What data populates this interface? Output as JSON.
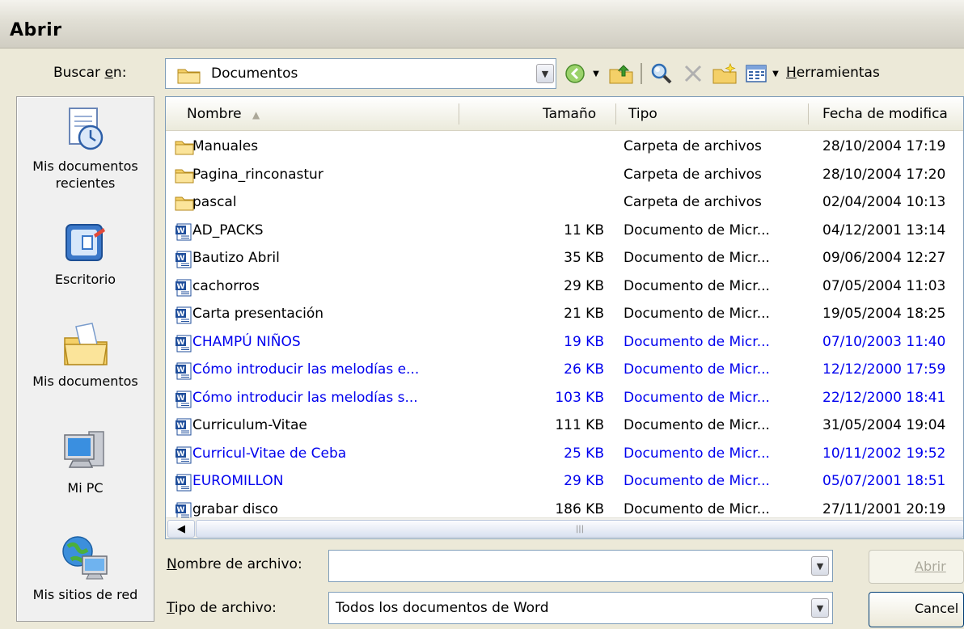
{
  "window": {
    "title": "Abrir"
  },
  "look_in": {
    "label_pre": "Buscar ",
    "label_key": "e",
    "label_post": "n:",
    "value": "Documentos"
  },
  "toolbar": {
    "tools_label_key": "H",
    "tools_label_rest": "erramientas"
  },
  "places": [
    {
      "line1": "Mis documentos",
      "line2": "recientes",
      "icon": "recent-documents-icon"
    },
    {
      "line1": "Escritorio",
      "line2": "",
      "icon": "desktop-icon"
    },
    {
      "line1": "Mis documentos",
      "line2": "",
      "icon": "my-documents-icon"
    },
    {
      "line1": "Mi PC",
      "line2": "",
      "icon": "my-computer-icon"
    },
    {
      "line1": "Mis sitios de red",
      "line2": "",
      "icon": "network-places-icon"
    }
  ],
  "columns": {
    "name": "Nombre",
    "size": "Tamaño",
    "type": "Tipo",
    "date": "Fecha de modifica"
  },
  "files": [
    {
      "name": "Manuales",
      "size": "",
      "type": "Carpeta de archivos",
      "date": "28/10/2004 17:19",
      "kind": "folder",
      "highlight": false
    },
    {
      "name": "Pagina_rinconastur",
      "size": "",
      "type": "Carpeta de archivos",
      "date": "28/10/2004 17:20",
      "kind": "folder",
      "highlight": false
    },
    {
      "name": "pascal",
      "size": "",
      "type": "Carpeta de archivos",
      "date": "02/04/2004 10:13",
      "kind": "folder",
      "highlight": false
    },
    {
      "name": "AD_PACKS",
      "size": "11 KB",
      "type": "Documento de Micr...",
      "date": "04/12/2001 13:14",
      "kind": "word",
      "highlight": false
    },
    {
      "name": "Bautizo Abril",
      "size": "35 KB",
      "type": "Documento de Micr...",
      "date": "09/06/2004 12:27",
      "kind": "word",
      "highlight": false
    },
    {
      "name": "cachorros",
      "size": "29 KB",
      "type": "Documento de Micr...",
      "date": "07/05/2004 11:03",
      "kind": "word",
      "highlight": false
    },
    {
      "name": "Carta presentación",
      "size": "21 KB",
      "type": "Documento de Micr...",
      "date": "19/05/2004 18:25",
      "kind": "word",
      "highlight": false
    },
    {
      "name": "CHAMPÚ   NIÑOS",
      "size": "19 KB",
      "type": "Documento de Micr...",
      "date": "07/10/2003 11:40",
      "kind": "word",
      "highlight": true
    },
    {
      "name": "Cómo introducir las melodías e...",
      "size": "26 KB",
      "type": "Documento de Micr...",
      "date": "12/12/2000 17:59",
      "kind": "word",
      "highlight": true
    },
    {
      "name": "Cómo introducir las melodías s...",
      "size": "103 KB",
      "type": "Documento de Micr...",
      "date": "22/12/2000 18:41",
      "kind": "word",
      "highlight": true
    },
    {
      "name": "Curriculum-Vitae",
      "size": "111 KB",
      "type": "Documento de Micr...",
      "date": "31/05/2004 19:04",
      "kind": "word",
      "highlight": false
    },
    {
      "name": "Curricul-Vitae de Ceba",
      "size": "25 KB",
      "type": "Documento de Micr...",
      "date": "10/11/2002 19:52",
      "kind": "word",
      "highlight": true
    },
    {
      "name": "EUROMILLON",
      "size": "29 KB",
      "type": "Documento de Micr...",
      "date": "05/07/2001 18:51",
      "kind": "word",
      "highlight": true
    },
    {
      "name": "grabar disco",
      "size": "186 KB",
      "type": "Documento de Micr...",
      "date": "27/11/2001 20:19",
      "kind": "word",
      "highlight": false
    }
  ],
  "filename": {
    "label_key": "N",
    "label_rest": "ombre de archivo:",
    "value": ""
  },
  "filetype": {
    "label_key": "T",
    "label_rest": "ipo de archivo:",
    "value": "Todos los documentos de Word"
  },
  "buttons": {
    "open": "Abrir",
    "cancel": "Cancel"
  },
  "colors": {
    "highlight_text": "#0000ee",
    "folder": "#f4d068",
    "word_blue": "#1f4e9b"
  }
}
